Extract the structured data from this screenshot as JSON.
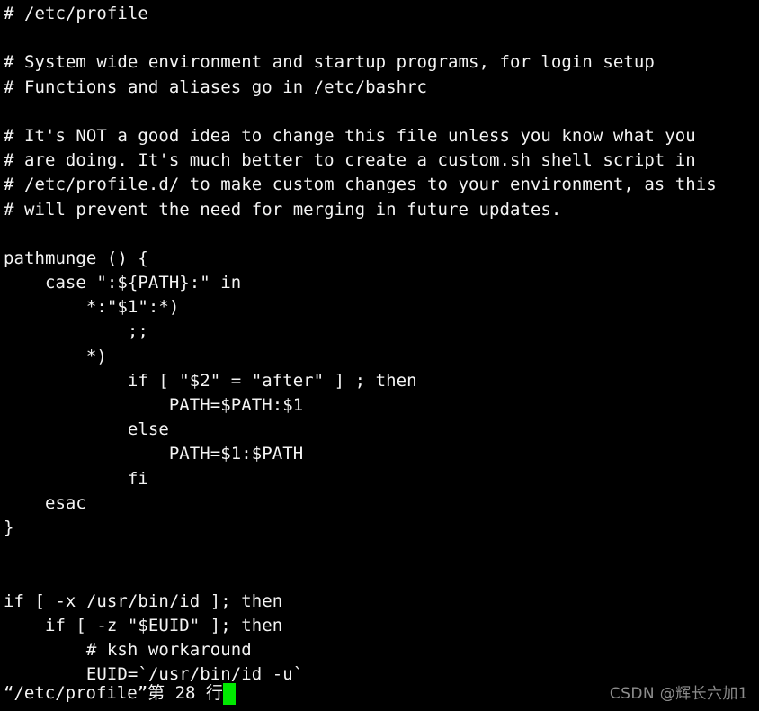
{
  "terminal": {
    "background_color": "#000000",
    "foreground_color": "#f4f4f4",
    "cursor_color": "#00e800",
    "title": "/etc/profile"
  },
  "editor": {
    "lines": [
      "# /etc/profile",
      "",
      "# System wide environment and startup programs, for login setup",
      "# Functions and aliases go in /etc/bashrc",
      "",
      "# It's NOT a good idea to change this file unless you know what you",
      "# are doing. It's much better to create a custom.sh shell script in",
      "# /etc/profile.d/ to make custom changes to your environment, as this",
      "# will prevent the need for merging in future updates.",
      "",
      "pathmunge () {",
      "    case \":${PATH}:\" in",
      "        *:\"$1\":*)",
      "            ;;",
      "        *)",
      "            if [ \"$2\" = \"after\" ] ; then",
      "                PATH=$PATH:$1",
      "            else",
      "                PATH=$1:$PATH",
      "            fi",
      "    esac",
      "}",
      "",
      "",
      "if [ -x /usr/bin/id ]; then",
      "    if [ -z \"$EUID\" ]; then",
      "        # ksh workaround",
      "        EUID=`/usr/bin/id -u`"
    ]
  },
  "status": {
    "file_label": "“/etc/profile”",
    "line_indicator": "第 28 行",
    "full_text": "“/etc/profile”第 28 行",
    "line_number": 28
  },
  "watermark": {
    "text": "CSDN @辉长六加1",
    "color": "#8d8d8d"
  }
}
